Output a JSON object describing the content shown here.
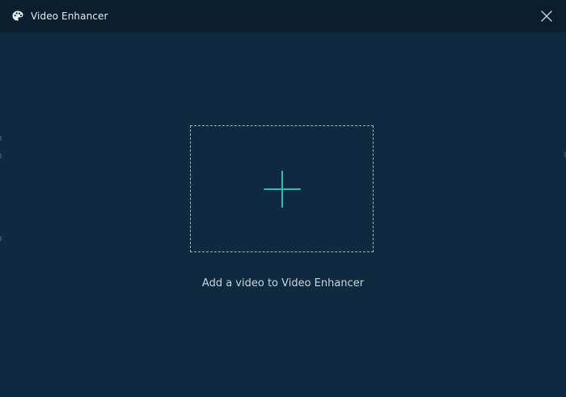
{
  "window": {
    "title": "Video Enhancer",
    "icons": {
      "app": "palette-icon",
      "close": "close-icon"
    }
  },
  "drop_zone": {
    "icon": "plus-icon",
    "hint": "Add a video to Video Enhancer"
  },
  "colors": {
    "background": "#0f2a40",
    "titlebar": "#0b1e2e",
    "accent": "#1fc2b3",
    "border": "#9fb2c2",
    "text": "#c7d3dd"
  }
}
